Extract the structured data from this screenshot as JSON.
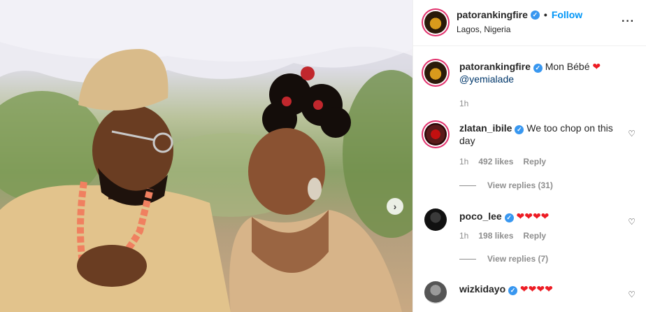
{
  "post": {
    "username": "patorankingfire",
    "follow_label": "Follow",
    "separator": "•",
    "location": "Lagos, Nigeria",
    "more_icon": "more-options-icon"
  },
  "caption": {
    "username": "patorankingfire",
    "text": "Mon Bébé",
    "heart": "❤",
    "mention": "@yemialade",
    "time": "1h"
  },
  "comments": [
    {
      "username": "zlatan_ibile",
      "verified": true,
      "text": "We too chop on this day",
      "time": "1h",
      "likes": "492 likes",
      "reply_label": "Reply",
      "view_replies": "View replies (31)"
    },
    {
      "username": "poco_lee",
      "verified": true,
      "text": "❤❤❤❤",
      "time": "1h",
      "likes": "198 likes",
      "reply_label": "Reply",
      "view_replies": "View replies (7)"
    },
    {
      "username": "wizkidayo",
      "verified": true,
      "text": "❤❤❤❤"
    }
  ],
  "icons": {
    "verified": "✓",
    "like": "♡",
    "next": "›",
    "more": "···"
  },
  "colors": {
    "accent": "#0095f6",
    "verified": "#3897f0",
    "heart": "#ed1c24",
    "muted": "#8e8e8e"
  }
}
